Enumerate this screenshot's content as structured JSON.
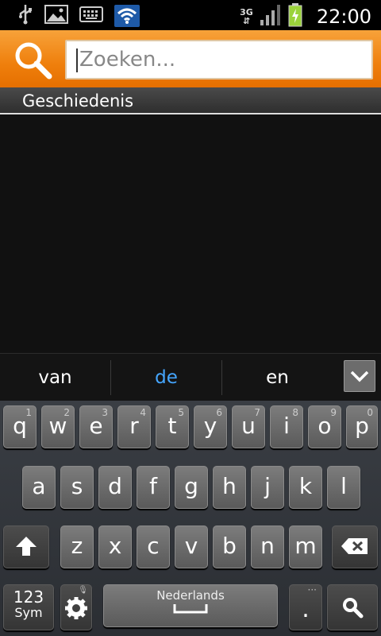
{
  "status_bar": {
    "time": "22:00",
    "network": "3G",
    "icons": [
      "usb-icon",
      "image-icon",
      "keyboard-icon",
      "wifi-icon",
      "signal-icon",
      "battery-charging-icon"
    ]
  },
  "search": {
    "placeholder": "Zoeken...",
    "icon": "search-icon",
    "accent_color": "#ef7f0c"
  },
  "history": {
    "label": "Geschiedenis"
  },
  "suggestions": {
    "left": "van",
    "center": "de",
    "right": "en",
    "toggle_icon": "chevron-down-icon",
    "highlight_color": "#45a6ff"
  },
  "keyboard": {
    "row1": [
      {
        "k": "q",
        "n": "1"
      },
      {
        "k": "w",
        "n": "2"
      },
      {
        "k": "e",
        "n": "3"
      },
      {
        "k": "r",
        "n": "4"
      },
      {
        "k": "t",
        "n": "5"
      },
      {
        "k": "y",
        "n": "6"
      },
      {
        "k": "u",
        "n": "7"
      },
      {
        "k": "i",
        "n": "8"
      },
      {
        "k": "o",
        "n": "9"
      },
      {
        "k": "p",
        "n": "0"
      }
    ],
    "row2": [
      "a",
      "s",
      "d",
      "f",
      "g",
      "h",
      "j",
      "k",
      "l"
    ],
    "row3": [
      "z",
      "x",
      "c",
      "v",
      "b",
      "n",
      "m"
    ],
    "sym_label_top": "123",
    "sym_label_bottom": "Sym",
    "space_label": "Nederlands",
    "period": ".",
    "shift_icon": "shift-arrow-icon",
    "backspace_icon": "backspace-icon",
    "settings_icon": "gear-icon",
    "search_key_icon": "search-icon"
  }
}
